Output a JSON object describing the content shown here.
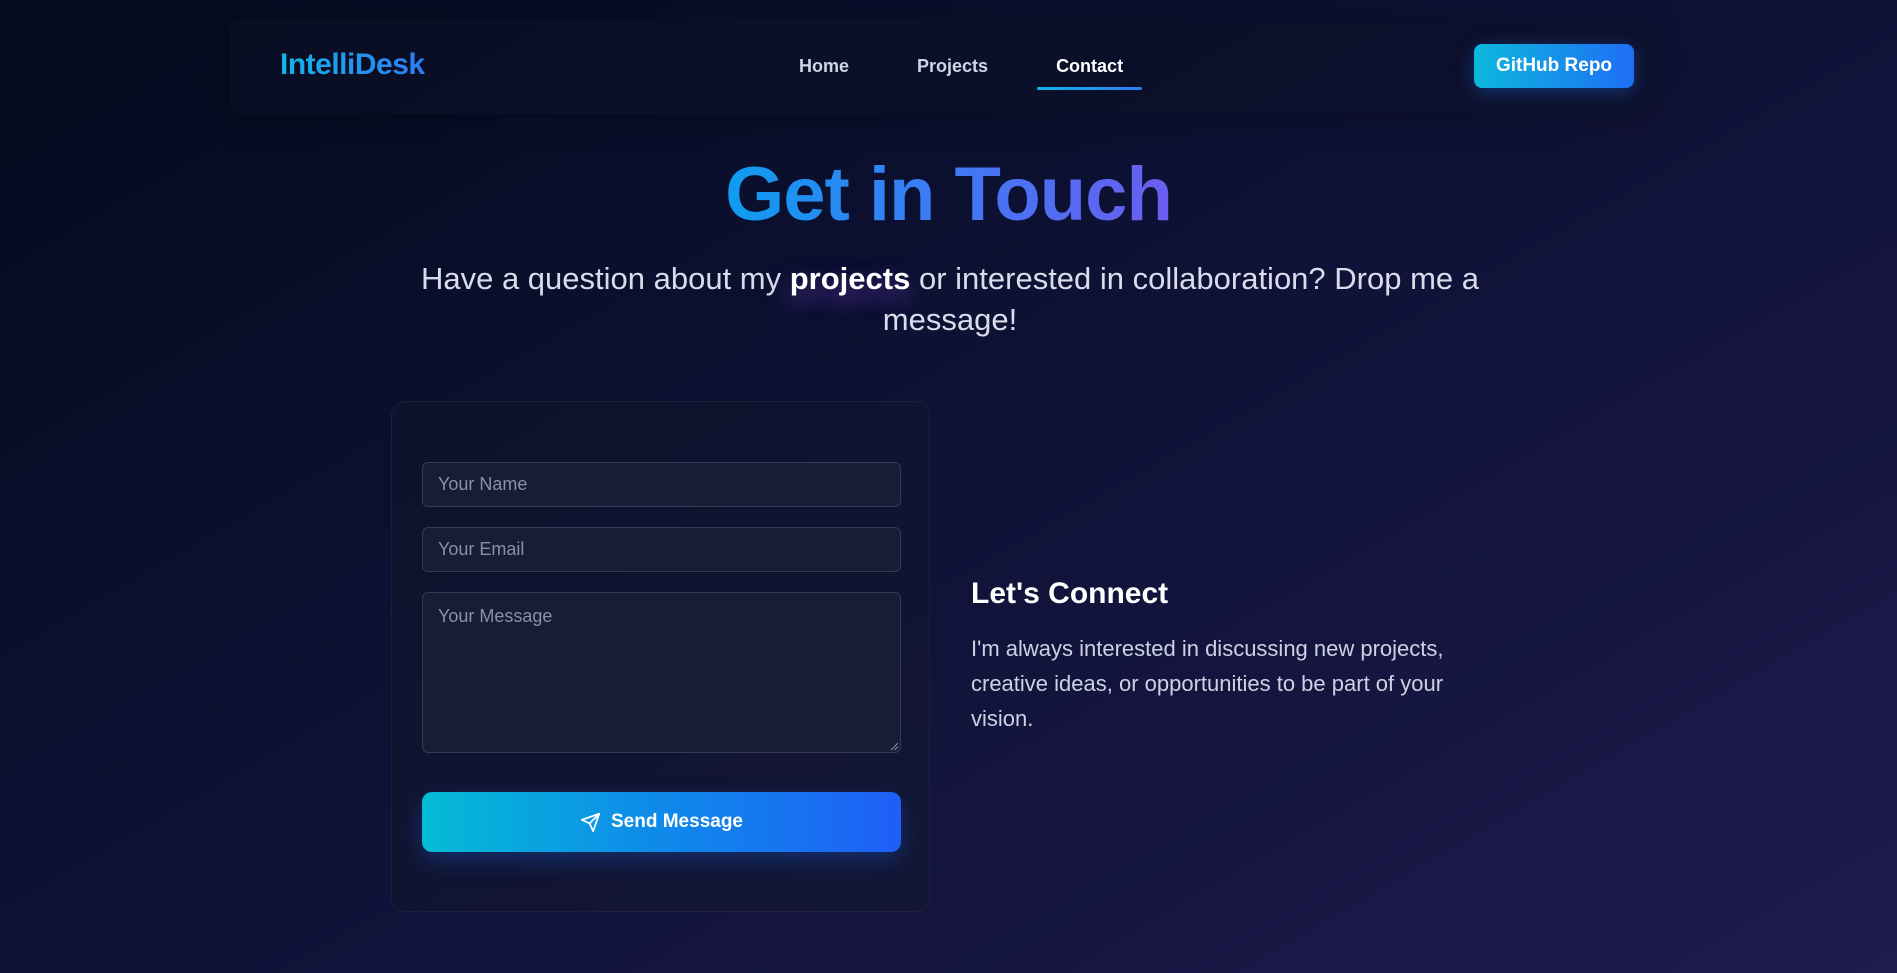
{
  "nav": {
    "brand": "IntelliDesk",
    "links": [
      {
        "label": "Home",
        "active": false
      },
      {
        "label": "Projects",
        "active": false
      },
      {
        "label": "Contact",
        "active": true
      }
    ],
    "github_label": "GitHub Repo"
  },
  "hero": {
    "title": "Get in Touch",
    "subtitle_before": "Have a question about my ",
    "subtitle_highlight": "projects",
    "subtitle_after": " or interested in collaboration? Drop me a message!"
  },
  "form": {
    "name_placeholder": "Your Name",
    "email_placeholder": "Your Email",
    "message_placeholder": "Your Message",
    "name_value": "",
    "email_value": "",
    "message_value": "",
    "submit_label": "Send Message",
    "submit_icon": "send-icon"
  },
  "connect": {
    "title": "Let's Connect",
    "text": "I'm always interested in discussing new projects, creative ideas, or opportunities to be part of your vision."
  },
  "colors": {
    "accent_start": "#0cb8dc",
    "accent_end": "#1f6ef5",
    "title_gradient_end": "#6a5ef0",
    "background": "#0b1030"
  }
}
